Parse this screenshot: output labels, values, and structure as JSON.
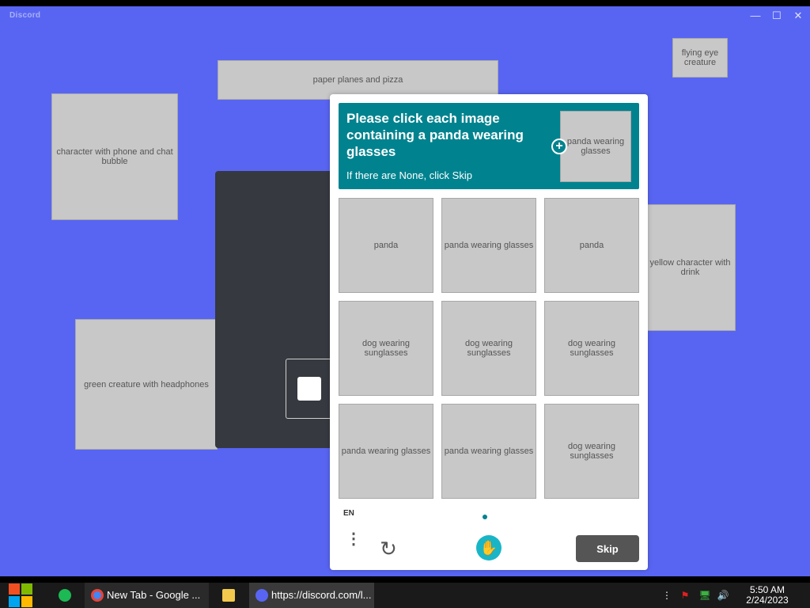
{
  "window": {
    "app_name": "Discord",
    "controls": {
      "minimize": "—",
      "maximize": "☐",
      "close": "✕"
    }
  },
  "captcha": {
    "prompt": "Please click each image containing a panda wearing glasses",
    "subtext": "If there are None, click Skip",
    "add_icon": "+",
    "example_image": "panda wearing glasses",
    "tiles": [
      "panda",
      "panda wearing glasses",
      "panda",
      "dog wearing sunglasses",
      "dog wearing sunglasses",
      "dog wearing sunglasses",
      "panda wearing glasses",
      "panda wearing glasses",
      "dog wearing sunglasses"
    ],
    "language": "EN",
    "menu_icon": "⋮",
    "refresh_icon": "↻",
    "logo_icon": "✋",
    "skip_label": "Skip",
    "accent_color": "#00838f"
  },
  "illustrations": {
    "hoodie_character": "character with phone and chat bubble",
    "green_dinosaur": "green creature with headphones",
    "yellow_character": "yellow character with drink",
    "top_decor": "paper planes and pizza",
    "eye_creature": "flying eye creature"
  },
  "taskbar": {
    "chrome_task": "New Tab - Google ...",
    "discord_task": "https://discord.com/l...",
    "clock_time": "5:50 AM",
    "clock_date": "2/24/2023",
    "tray_more": "⋮",
    "tray_flag": "⚑",
    "tray_network": "🖥",
    "tray_volume": "🔊"
  }
}
